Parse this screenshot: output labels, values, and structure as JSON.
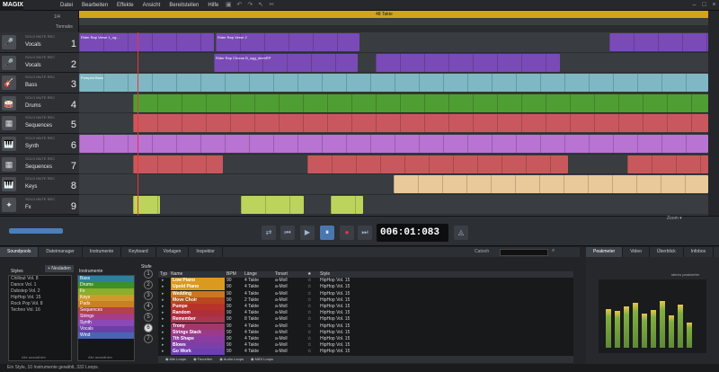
{
  "app": {
    "logo": "MAGIX"
  },
  "menu": [
    "Datei",
    "Bearbeiten",
    "Effekte",
    "Ansicht",
    "Bereitstellen",
    "Hilfe"
  ],
  "ruler": {
    "bar_label": "48 Takte",
    "timesig": "1/4",
    "tempo_left": "Tonnabs"
  },
  "tracks": [
    {
      "name": "Vocals",
      "num": "1",
      "icon": "🎤",
      "color": "#7a4bb7"
    },
    {
      "name": "Vocals",
      "num": "2",
      "icon": "🎤",
      "color": "#7a4bb7"
    },
    {
      "name": "Bass",
      "num": "3",
      "icon": "🎸",
      "color": "#7fb8c4"
    },
    {
      "name": "Drums",
      "num": "4",
      "icon": "🥁",
      "color": "#4f9e33"
    },
    {
      "name": "Sequences",
      "num": "5",
      "icon": "▦",
      "color": "#c9585e"
    },
    {
      "name": "Synth",
      "num": "6",
      "icon": "🎹",
      "color": "#b873d3"
    },
    {
      "name": "Sequences",
      "num": "7",
      "icon": "▦",
      "color": "#c9585e"
    },
    {
      "name": "Keys",
      "num": "8",
      "icon": "🎹",
      "color": "#e9c999"
    },
    {
      "name": "Fx",
      "num": "9",
      "icon": "✦",
      "color": "#bcd45b"
    }
  ],
  "track_buttons": "SOLO  MUTE  REC",
  "clip_labels": {
    "v1": "Rider Rap Verse 1_og...",
    "v2a": "Rider Rap Verse 2",
    "v2b": "Rider Rap Chorus B_ogg_dmmRP",
    "bass": "Pumped Bass"
  },
  "transport": {
    "timecode": "006:01:083",
    "zoom": "Zoom ▾"
  },
  "mediapool": {
    "tabs": [
      "Soundpools",
      "Dateimanager",
      "Instrumente",
      "Keyboard",
      "Vorlagen",
      "Inspektor"
    ],
    "active_tab": "Soundpools",
    "catooh": "Catooh",
    "styles_label": "Styles",
    "new_btn": "+ Neuladen",
    "styles": [
      "Chillout Vol. 8",
      "Dance Vol. 1",
      "Dubstep Vol. 2",
      "HipHop Vol. 15",
      "Rock Pop Vol. 8",
      "Techno Vol. 16"
    ],
    "instruments_label": "Instrumente",
    "instruments": [
      {
        "name": "Bass",
        "color": "#2f7f9b"
      },
      {
        "name": "Drums",
        "color": "#3f8f2a"
      },
      {
        "name": "Fx",
        "color": "#8cae2d"
      },
      {
        "name": "Keys",
        "color": "#cf9a2d"
      },
      {
        "name": "Pads",
        "color": "#c97f23"
      },
      {
        "name": "Sequences",
        "color": "#b2414a"
      },
      {
        "name": "Strings",
        "color": "#a63d88"
      },
      {
        "name": "Synth",
        "color": "#8b49b5"
      },
      {
        "name": "Vocals",
        "color": "#6840a8"
      },
      {
        "name": "Wind",
        "color": "#4a64b2"
      }
    ],
    "select_all": "Alle auswählen",
    "stufe_label": "Stufe",
    "stufen": [
      "1",
      "2",
      "3",
      "4",
      "5",
      "6",
      "7"
    ],
    "selected_stufe": "6",
    "columns": [
      "Typ",
      "Name",
      "BPM",
      "Länge",
      "Tonart",
      "★",
      "Style"
    ],
    "loops": [
      {
        "name": "Low Piano",
        "color": "#d99a1f",
        "bpm": "90",
        "len": "4 Takte",
        "key": "a-Moll",
        "style": "HipHop Vol. 15"
      },
      {
        "name": "Upold Piano",
        "color": "#d99a1f",
        "bpm": "90",
        "len": "4 Takte",
        "key": "a-Moll",
        "style": "HipHop Vol. 15"
      },
      {
        "name": "Wedding",
        "color": "#c9781d",
        "bpm": "90",
        "len": "4 Takte",
        "key": "a-Moll",
        "style": "HipHop Vol. 15"
      },
      {
        "name": "Move Choir",
        "color": "#b8471f",
        "bpm": "90",
        "len": "2 Takte",
        "key": "a-Moll",
        "style": "HipHop Vol. 15"
      },
      {
        "name": "Pumpe",
        "color": "#b83328",
        "bpm": "90",
        "len": "4 Takte",
        "key": "a-Moll",
        "style": "HipHop Vol. 15"
      },
      {
        "name": "Random",
        "color": "#ae2e3b",
        "bpm": "90",
        "len": "4 Takte",
        "key": "a-Moll",
        "style": "HipHop Vol. 15"
      },
      {
        "name": "Remember",
        "color": "#a9354e",
        "bpm": "90",
        "len": "8 Takte",
        "key": "a-Moll",
        "style": "HipHop Vol. 15"
      },
      {
        "name": "Trony",
        "color": "#a2376c",
        "bpm": "90",
        "len": "4 Takte",
        "key": "a-Moll",
        "style": "HipHop Vol. 15"
      },
      {
        "name": "Strings Stack",
        "color": "#9a3a8a",
        "bpm": "90",
        "len": "4 Takte",
        "key": "a-Moll",
        "style": "HipHop Vol. 15"
      },
      {
        "name": "7th Shape",
        "color": "#8b3c9e",
        "bpm": "90",
        "len": "4 Takte",
        "key": "a-Moll",
        "style": "HipHop Vol. 15"
      },
      {
        "name": "Blows",
        "color": "#7c3fa8",
        "bpm": "90",
        "len": "4 Takte",
        "key": "a-Moll",
        "style": "HipHop Vol. 15"
      },
      {
        "name": "Go Work",
        "color": "#6c40b0",
        "bpm": "90",
        "len": "4 Takte",
        "key": "a-Moll",
        "style": "HipHop Vol. 15"
      }
    ],
    "footer": [
      "Alle Loops",
      "Favoriten",
      "Audio Loops",
      "MIDI Loops"
    ],
    "status": "Ein Style, 10 Instrumente gewählt, 332 Loops."
  },
  "right_panel": {
    "tabs": [
      "Peakmeter",
      "Video",
      "Überblick",
      "Infobox"
    ],
    "meter_title": "stereo peakmeter",
    "levels": [
      0.62,
      0.58,
      0.66,
      0.71,
      0.55,
      0.6,
      0.74,
      0.52,
      0.68,
      0.4
    ]
  }
}
